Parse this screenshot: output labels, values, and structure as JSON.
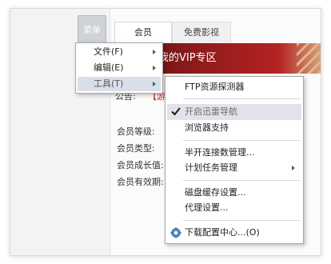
{
  "toolbar": {
    "menu_label": "菜单"
  },
  "tabs": [
    {
      "label": "会员",
      "active": true
    },
    {
      "label": "免费影视",
      "active": false
    }
  ],
  "banner": {
    "text": "我的VIP专区"
  },
  "notice": {
    "label": "公告:",
    "text": "【游戏"
  },
  "member_info": [
    "会员等级:",
    "会员类型:",
    "会员成长值:",
    "会员有效期:"
  ],
  "main_menu": [
    {
      "label": "文件(F)",
      "has_submenu": true,
      "highlighted": false
    },
    {
      "label": "编辑(E)",
      "has_submenu": true,
      "highlighted": false
    },
    {
      "label": "工具(T)",
      "has_submenu": true,
      "highlighted": true
    }
  ],
  "tools_menu": [
    {
      "label": "FTP资源探测器"
    },
    {
      "label": "开启迅雷导航",
      "checked": true,
      "highlighted": true
    },
    {
      "label": "浏览器支持"
    },
    {
      "label": "半开连接数管理..."
    },
    {
      "label": "计划任务管理",
      "has_submenu": true
    },
    {
      "label": "磁盘缓存设置..."
    },
    {
      "label": "代理设置..."
    },
    {
      "label": "下载配置中心...(O)",
      "icon": "gear-icon"
    }
  ],
  "colors": {
    "banner_red": "#8d1b1b",
    "notice_red": "#d21c1c",
    "menu_highlight": "#d9dfe8"
  }
}
